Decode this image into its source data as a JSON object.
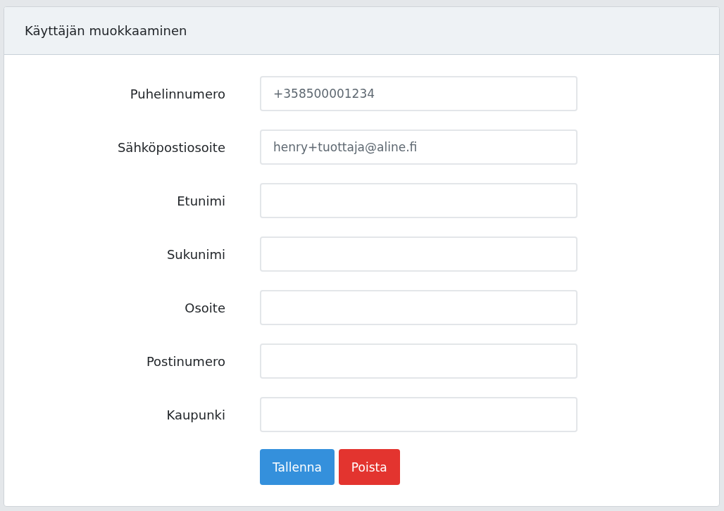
{
  "card": {
    "title": "Käyttäjän muokkaaminen"
  },
  "fields": [
    {
      "label": "Puhelinnumero",
      "value": "+358500001234"
    },
    {
      "label": "Sähköpostiosoite",
      "value": "henry+tuottaja@aline.fi"
    },
    {
      "label": "Etunimi"
    },
    {
      "label": "Sukunimi"
    },
    {
      "label": "Osoite"
    },
    {
      "label": "Postinumero"
    },
    {
      "label": "Kaupunki"
    }
  ],
  "buttons": [
    {
      "label": "Tallenna",
      "kind": "primary"
    },
    {
      "label": "Poista",
      "kind": "danger"
    }
  ]
}
